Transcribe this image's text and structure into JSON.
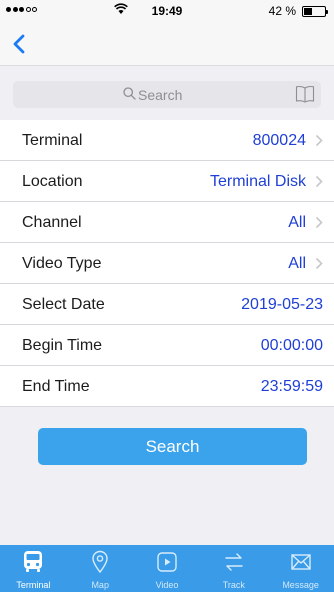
{
  "status_bar": {
    "time": "19:49",
    "battery": "42 %",
    "battery_level": 0.42
  },
  "nav": {
    "back_icon": "chevron-left-icon"
  },
  "search": {
    "placeholder": "Search",
    "icon": "search-icon",
    "trailing_icon": "book-icon"
  },
  "form": {
    "rows": [
      {
        "label": "Terminal",
        "value": "800024"
      },
      {
        "label": "Location",
        "value": "Terminal Disk"
      },
      {
        "label": "Channel",
        "value": "All"
      },
      {
        "label": "Video Type",
        "value": "All"
      },
      {
        "label": "Select Date",
        "value": "2019-05-23"
      },
      {
        "label": "Begin Time",
        "value": "00:00:00"
      },
      {
        "label": "End Time",
        "value": "23:59:59"
      }
    ]
  },
  "actions": {
    "search_label": "Search"
  },
  "tabbar": {
    "tabs": [
      {
        "label": "Terminal",
        "icon": "bus-icon"
      },
      {
        "label": "Map",
        "icon": "location-pin-icon"
      },
      {
        "label": "Video",
        "icon": "play-icon"
      },
      {
        "label": "Track",
        "icon": "swap-arrows-icon"
      },
      {
        "label": "Message",
        "icon": "envelope-icon"
      }
    ]
  },
  "colors": {
    "accent": "#3aa3ec",
    "value_text": "#1f3fd6",
    "tabbar": "#3a9ce8"
  }
}
